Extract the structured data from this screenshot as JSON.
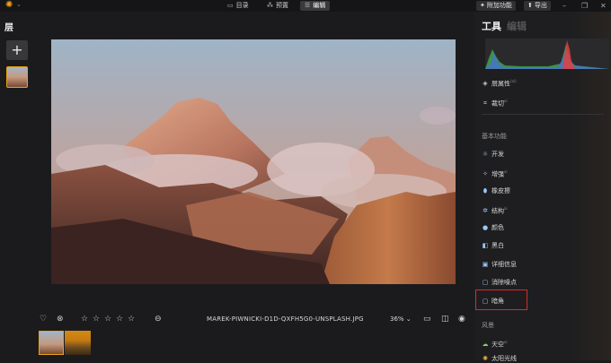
{
  "topbar": {
    "tabs": [
      {
        "label": "目录",
        "icon": "folder-icon",
        "active": false
      },
      {
        "label": "预置",
        "icon": "presets-icon",
        "active": false
      },
      {
        "label": "编辑",
        "icon": "sliders-icon",
        "active": true
      }
    ],
    "addons_label": "附加功能",
    "export_label": "导出"
  },
  "layers": {
    "title": "层",
    "add_label": "+"
  },
  "photo": {
    "filename": "MAREK-PIWNICKI-D1D-QXFH5G0-UNSPLASH.JPG",
    "zoom": "36%"
  },
  "right_panel": {
    "tab_tools": "工具",
    "tab_edit": "编辑",
    "top_items": [
      {
        "label": "层属性",
        "icon": "layers-icon",
        "sup": "(ai)"
      },
      {
        "label": "裁切",
        "icon": "crop-icon",
        "sup": "ai"
      }
    ],
    "basic_section": "基本功能",
    "basic_items": [
      {
        "label": "开发",
        "icon": "sun-icon",
        "sup": ""
      },
      {
        "label": "增强",
        "icon": "sparkle-icon",
        "sup": "ai"
      },
      {
        "label": "橡皮擦",
        "icon": "eraser-icon",
        "sup": ""
      },
      {
        "label": "结构",
        "icon": "structure-icon",
        "sup": "ai"
      },
      {
        "label": "颜色",
        "icon": "color-icon",
        "sup": ""
      },
      {
        "label": "黑白",
        "icon": "bw-icon",
        "sup": ""
      },
      {
        "label": "详细信息",
        "icon": "details-icon",
        "sup": ""
      },
      {
        "label": "消除噪点",
        "icon": "denoise-icon",
        "sup": ""
      },
      {
        "label": "暗角",
        "icon": "vignette-icon",
        "sup": ""
      }
    ],
    "landscape_section": "风景",
    "landscape_items": [
      {
        "label": "天空",
        "icon": "cloud-icon",
        "sup": "ai"
      },
      {
        "label": "太阳光线",
        "icon": "sunrays-icon",
        "sup": ""
      }
    ]
  },
  "colors": {
    "accent_orange": "#e8a317",
    "highlight_red": "#d82a2a",
    "icon_blue": "#9ac7ff"
  }
}
